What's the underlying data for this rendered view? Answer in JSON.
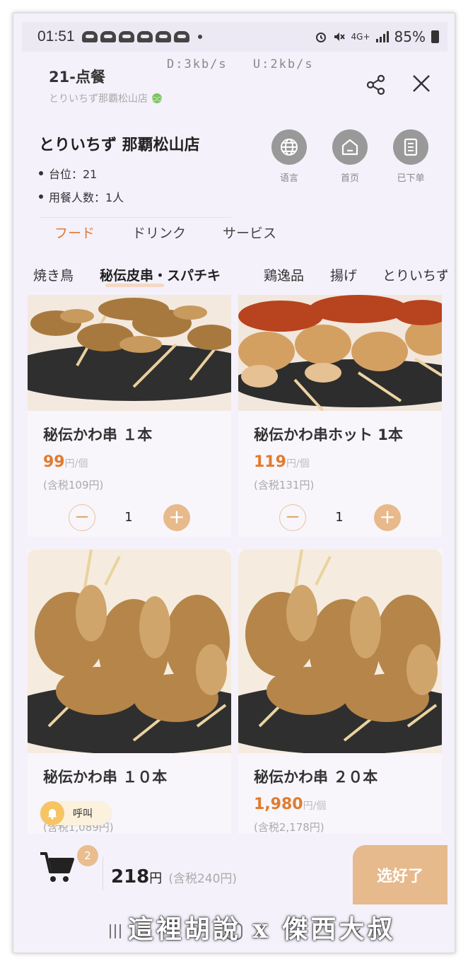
{
  "status_bar": {
    "time": "01:51",
    "battery": "85%",
    "network": "4G+"
  },
  "header": {
    "title": "21-点餐",
    "subtitle": "とりいちず那覇松山店",
    "net_down": "D:3kb/s",
    "net_up": "U:2kb/s"
  },
  "store": {
    "name": "とりいちず 那覇松山店",
    "table": "台位：21",
    "diners": "用餐人数：1人",
    "actions": [
      {
        "label": "语言",
        "icon": "globe-icon"
      },
      {
        "label": "首页",
        "icon": "home-icon"
      },
      {
        "label": "已下单",
        "icon": "receipt-icon"
      }
    ]
  },
  "tabs": [
    "フード",
    "ドリンク",
    "サービス"
  ],
  "active_tab": "フード",
  "categories": [
    "焼き鳥",
    "秘伝皮串・スパチキ",
    "鶏逸品",
    "揚げ",
    "とりいちず"
  ],
  "active_category": "秘伝皮串・スパチキ",
  "products": [
    {
      "name": "秘伝かわ串 １本",
      "price": "99",
      "unit": "円/個",
      "tax": "(含税109円)",
      "qty": "1"
    },
    {
      "name": "秘伝かわ串ホット 1本",
      "price": "119",
      "unit": "円/個",
      "tax": "(含税131円)",
      "qty": "1"
    },
    {
      "name": "秘伝かわ串 １０本",
      "price": "",
      "unit": "",
      "tax": "(含税1,089円)",
      "qty": ""
    },
    {
      "name": "秘伝かわ串 ２０本",
      "price": "1,980",
      "unit": "円/個",
      "tax": "(含税2,178円)",
      "qty": ""
    }
  ],
  "call_button": "呼叫",
  "cart": {
    "count": "2",
    "total": "218",
    "currency": "円",
    "total_tax": "(含税240円)",
    "done_label": "选好了"
  },
  "watermark": "這裡胡說 x 傑西大叔",
  "colors": {
    "accent": "#e07b2e",
    "button": "#e6ba8d",
    "background": "#f4f1fb"
  }
}
